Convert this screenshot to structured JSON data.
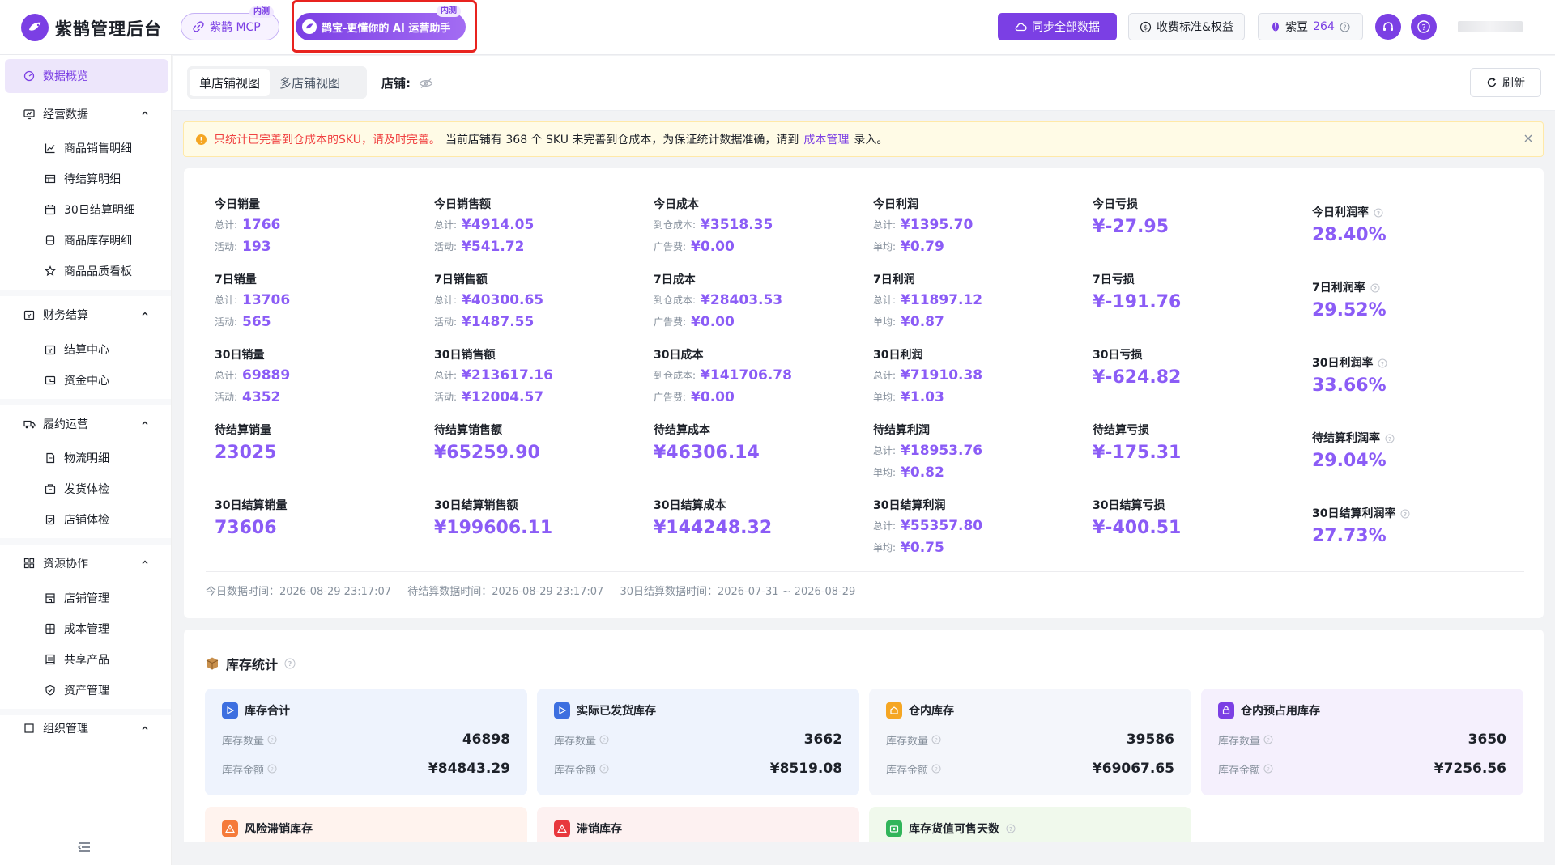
{
  "app": {
    "title": "紫鹊管理后台"
  },
  "header": {
    "mcp": {
      "label": "紫鹊 MCP",
      "tag": "内测"
    },
    "ai": {
      "label": "鹊宝-更懂你的 AI 运营助手",
      "tag": "内测"
    },
    "sync_label": "同步全部数据",
    "fee_label": "收费标准&权益",
    "bean_label": "紫豆",
    "bean_count": "264"
  },
  "sidebar": {
    "overview": "数据概览",
    "groups": [
      {
        "label": "经营数据",
        "items": [
          "商品销售明细",
          "待结算明细",
          "30日结算明细",
          "商品库存明细",
          "商品品质看板"
        ]
      },
      {
        "label": "财务结算",
        "items": [
          "结算中心",
          "资金中心"
        ]
      },
      {
        "label": "履约运营",
        "items": [
          "物流明细",
          "发货体检",
          "店铺体检"
        ]
      },
      {
        "label": "资源协作",
        "items": [
          "店铺管理",
          "成本管理",
          "共享产品",
          "资产管理"
        ]
      },
      {
        "label": "组织管理",
        "items": []
      }
    ]
  },
  "toolbar": {
    "tabs": [
      "单店铺视图",
      "多店铺视图"
    ],
    "shop_label": "店铺:",
    "refresh_label": "刷新"
  },
  "notice": {
    "red_text": "只统计已完善到仓成本的SKU，请及时完善。",
    "text_before": "当前店铺有 368 个 SKU 未完善到仓成本，为保证统计数据准确，请到",
    "link": "成本管理",
    "text_after": "录入。"
  },
  "stats": {
    "rows": [
      [
        {
          "title": "今日销量",
          "r1k": "总计:",
          "r1v": "1766",
          "r2k": "活动:",
          "r2v": "193"
        },
        {
          "title": "今日销售额",
          "r1k": "总计:",
          "r1v": "¥4914.05",
          "r2k": "活动:",
          "r2v": "¥541.72"
        },
        {
          "title": "今日成本",
          "r1k": "到仓成本:",
          "r1v": "¥3518.35",
          "r2k": "广告费:",
          "r2v": "¥0.00"
        },
        {
          "title": "今日利润",
          "r1k": "总计:",
          "r1v": "¥1395.70",
          "r2k": "单均:",
          "r2v": "¥0.79"
        },
        {
          "title": "今日亏损",
          "big": "¥-27.95"
        },
        {
          "title": "今日利润率",
          "big": "28.40%"
        }
      ],
      [
        {
          "title": "7日销量",
          "r1k": "总计:",
          "r1v": "13706",
          "r2k": "活动:",
          "r2v": "565"
        },
        {
          "title": "7日销售额",
          "r1k": "总计:",
          "r1v": "¥40300.65",
          "r2k": "活动:",
          "r2v": "¥1487.55"
        },
        {
          "title": "7日成本",
          "r1k": "到仓成本:",
          "r1v": "¥28403.53",
          "r2k": "广告费:",
          "r2v": "¥0.00"
        },
        {
          "title": "7日利润",
          "r1k": "总计:",
          "r1v": "¥11897.12",
          "r2k": "单均:",
          "r2v": "¥0.87"
        },
        {
          "title": "7日亏损",
          "big": "¥-191.76"
        },
        {
          "title": "7日利润率",
          "big": "29.52%"
        }
      ],
      [
        {
          "title": "30日销量",
          "r1k": "总计:",
          "r1v": "69889",
          "r2k": "活动:",
          "r2v": "4352"
        },
        {
          "title": "30日销售额",
          "r1k": "总计:",
          "r1v": "¥213617.16",
          "r2k": "活动:",
          "r2v": "¥12004.57"
        },
        {
          "title": "30日成本",
          "r1k": "到仓成本:",
          "r1v": "¥141706.78",
          "r2k": "广告费:",
          "r2v": "¥0.00"
        },
        {
          "title": "30日利润",
          "r1k": "总计:",
          "r1v": "¥71910.38",
          "r2k": "单均:",
          "r2v": "¥1.03"
        },
        {
          "title": "30日亏损",
          "big": "¥-624.82"
        },
        {
          "title": "30日利润率",
          "big": "33.66%"
        }
      ],
      [
        {
          "title": "待结算销量",
          "big": "23025"
        },
        {
          "title": "待结算销售额",
          "big": "¥65259.90"
        },
        {
          "title": "待结算成本",
          "big": "¥46306.14"
        },
        {
          "title": "待结算利润",
          "r1k": "总计:",
          "r1v": "¥18953.76",
          "r2k": "单均:",
          "r2v": "¥0.82"
        },
        {
          "title": "待结算亏损",
          "big": "¥-175.31"
        },
        {
          "title": "待结算利润率",
          "big": "29.04%"
        }
      ],
      [
        {
          "title": "30日结算销量",
          "big": "73606"
        },
        {
          "title": "30日结算销售额",
          "big": "¥199606.11"
        },
        {
          "title": "30日结算成本",
          "big": "¥144248.32"
        },
        {
          "title": "30日结算利润",
          "r1k": "总计:",
          "r1v": "¥55357.80",
          "r2k": "单均:",
          "r2v": "¥0.75"
        },
        {
          "title": "30日结算亏损",
          "big": "¥-400.51"
        },
        {
          "title": "30日结算利润率",
          "big": "27.73%"
        }
      ]
    ],
    "times": {
      "today": "今日数据时间：2026-08-29 23:17:07",
      "pending": "待结算数据时间：2026-08-29 23:17:07",
      "thirty": "30日结算数据时间：2026-07-31 ~ 2026-08-29"
    }
  },
  "inventory": {
    "title": "库存统计",
    "qty_label": "库存数量",
    "amt_label": "库存金额",
    "cards": [
      {
        "title": "库存合计",
        "qty": "46898",
        "amt": "¥84843.29",
        "color": "#3d6fe0"
      },
      {
        "title": "实际已发货库存",
        "qty": "3662",
        "amt": "¥8519.08",
        "color": "#3d6fe0"
      },
      {
        "title": "仓内库存",
        "qty": "39586",
        "amt": "¥69067.65",
        "color": "#f5a623"
      },
      {
        "title": "仓内预占用库存",
        "qty": "3650",
        "amt": "¥7256.56",
        "color": "#7b3fe4"
      },
      {
        "title": "风险滞销库存",
        "color": "#f57a3a"
      },
      {
        "title": "滞销库存",
        "color": "#e8383d"
      },
      {
        "title": "库存货值可售天数",
        "color": "#31b55a"
      }
    ]
  },
  "colors": {
    "accent": "#7b3fe4",
    "value": "#8b5cf6",
    "warn": "#f04242"
  }
}
